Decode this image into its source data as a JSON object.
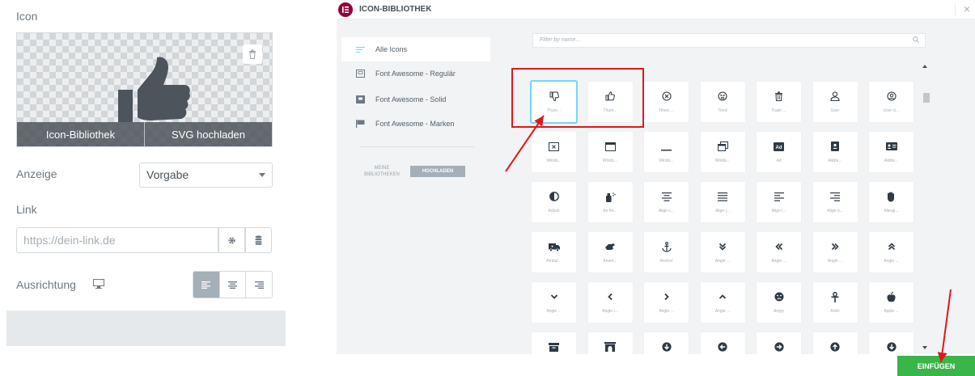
{
  "left_panel": {
    "icon_label": "Icon",
    "preview": {
      "buttons": [
        "Icon-Bibliothek",
        "SVG hochladen"
      ]
    },
    "display": {
      "label": "Anzeige",
      "value": "Vorgabe"
    },
    "link": {
      "label": "Link",
      "placeholder": "https://dein-link.de"
    },
    "alignment": {
      "label": "Ausrichtung",
      "options": [
        "left",
        "center",
        "right"
      ],
      "selected": "left"
    }
  },
  "modal": {
    "title": "ICON-BIBLIOTHEK",
    "close": "×",
    "sidebar": {
      "items": [
        {
          "label": "Alle Icons",
          "icon": "list-icon",
          "active": true
        },
        {
          "label": "Font Awesome - Regulär",
          "icon": "flag-outline-icon",
          "active": false
        },
        {
          "label": "Font Awesome - Solid",
          "icon": "square-solid-icon",
          "active": false
        },
        {
          "label": "Font Awesome - Marken",
          "icon": "flag-solid-icon",
          "active": false
        }
      ],
      "my_libraries": "MEINE BIBLIOTHEKEN",
      "upload_button": "HOCHLADEN"
    },
    "filter_placeholder": "Filter by name...",
    "icons": [
      {
        "name": "Thum...",
        "glyph": "thumbs-down-icon",
        "selected": true
      },
      {
        "name": "Thum...",
        "glyph": "thumbs-up-icon"
      },
      {
        "name": "Times ...",
        "glyph": "times-circle-icon"
      },
      {
        "name": "Tired",
        "glyph": "tired-icon"
      },
      {
        "name": "Trash ...",
        "glyph": "trash-icon"
      },
      {
        "name": "User",
        "glyph": "user-icon"
      },
      {
        "name": "User ci...",
        "glyph": "user-circle-icon"
      },
      {
        "name": "Windo...",
        "glyph": "window-close-icon"
      },
      {
        "name": "Windo...",
        "glyph": "window-maximize-icon"
      },
      {
        "name": "Windo...",
        "glyph": "window-minimize-icon"
      },
      {
        "name": "Windo...",
        "glyph": "window-restore-icon"
      },
      {
        "name": "Ad",
        "glyph": "ad-icon"
      },
      {
        "name": "Addre...",
        "glyph": "address-book-icon"
      },
      {
        "name": "Addre...",
        "glyph": "address-card-icon"
      },
      {
        "name": "Adjust",
        "glyph": "adjust-icon"
      },
      {
        "name": "Air fre...",
        "glyph": "air-freshener-icon"
      },
      {
        "name": "Align c...",
        "glyph": "align-center-icon"
      },
      {
        "name": "Align j...",
        "glyph": "align-justify-icon"
      },
      {
        "name": "Align l...",
        "glyph": "align-left-icon"
      },
      {
        "name": "Align ri...",
        "glyph": "align-right-icon"
      },
      {
        "name": "Allergi...",
        "glyph": "allergies-icon"
      },
      {
        "name": "Ambul...",
        "glyph": "ambulance-icon"
      },
      {
        "name": "Ameri...",
        "glyph": "asl-icon"
      },
      {
        "name": "Anchor",
        "glyph": "anchor-icon"
      },
      {
        "name": "Angle ...",
        "glyph": "angle-double-down-icon"
      },
      {
        "name": "Angle ...",
        "glyph": "angle-double-left-icon"
      },
      {
        "name": "Angle ...",
        "glyph": "angle-double-right-icon"
      },
      {
        "name": "Angle ...",
        "glyph": "angle-double-up-icon"
      },
      {
        "name": "Angle ...",
        "glyph": "angle-down-icon"
      },
      {
        "name": "Angle l...",
        "glyph": "angle-left-icon"
      },
      {
        "name": "Angle ...",
        "glyph": "angle-right-icon"
      },
      {
        "name": "Angle ...",
        "glyph": "angle-up-icon"
      },
      {
        "name": "Angry",
        "glyph": "angry-icon"
      },
      {
        "name": "Ankh",
        "glyph": "ankh-icon"
      },
      {
        "name": "Apple ...",
        "glyph": "apple-icon"
      },
      {
        "name": "",
        "glyph": "archive-icon"
      },
      {
        "name": "",
        "glyph": "archway-icon"
      },
      {
        "name": "",
        "glyph": "arrow-circle-down-icon"
      },
      {
        "name": "",
        "glyph": "arrow-circle-left-icon"
      },
      {
        "name": "",
        "glyph": "arrow-circle-right-icon"
      },
      {
        "name": "",
        "glyph": "arrow-circle-up-icon"
      },
      {
        "name": "",
        "glyph": "arrow-circle-down-2-icon"
      }
    ],
    "insert_button": "EINFÜGEN"
  },
  "colors": {
    "insert_green": "#39b54a",
    "selection_blue": "#71d7f7",
    "annotation_red": "#e0171b",
    "brand": "#92003b"
  }
}
